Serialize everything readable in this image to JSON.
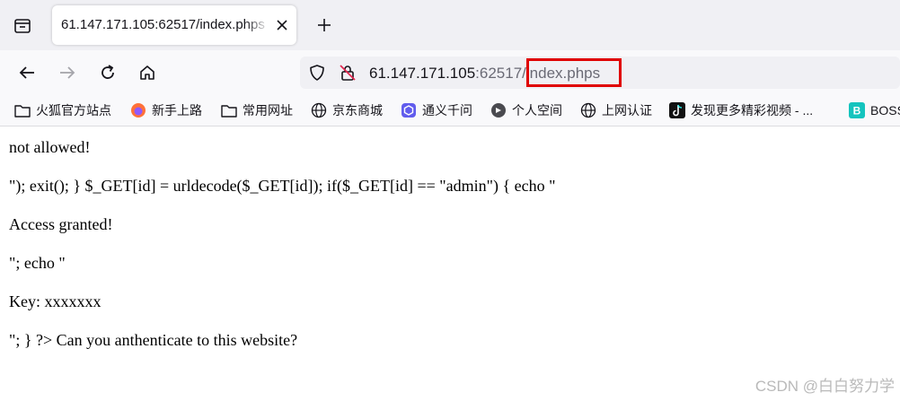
{
  "tab": {
    "title": "61.147.171.105:62517/index.phps"
  },
  "address": {
    "host": "61.147.171.105",
    "port": ":62517",
    "path": "/index.phps"
  },
  "bookmarks": [
    {
      "label": "火狐官方站点",
      "icon": "folder-icon"
    },
    {
      "label": "新手上路",
      "icon": "firefox-icon"
    },
    {
      "label": "常用网址",
      "icon": "folder-icon"
    },
    {
      "label": "京东商城",
      "icon": "globe-icon"
    },
    {
      "label": "通义千问",
      "icon": "tongyi-icon"
    },
    {
      "label": "个人空间",
      "icon": "bilibili-icon"
    },
    {
      "label": "上网认证",
      "icon": "globe-icon"
    },
    {
      "label": "发现更多精彩视频 - ...",
      "icon": "tiktok-icon"
    },
    {
      "label": "BOSS",
      "icon": "boss-icon"
    }
  ],
  "page": {
    "lines": [
      "not allowed!",
      "\"); exit(); } $_GET[id] = urldecode($_GET[id]); if($_GET[id] == \"admin\") { echo \"",
      "Access granted!",
      "\"; echo \"",
      "Key: xxxxxxx",
      "\"; } ?> Can you anthenticate to this website?"
    ]
  },
  "watermark": "CSDN @白白努力学",
  "colors": {
    "highlight": "#e00000",
    "toolbar": "#f9f9fb",
    "tabstrip": "#f0f0f4"
  }
}
